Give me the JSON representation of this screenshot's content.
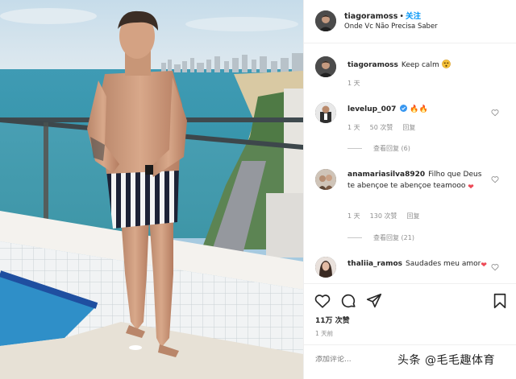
{
  "header": {
    "username": "tiagoramoss",
    "dot": "•",
    "follow_label": "关注",
    "location": "Onde Vc Não Precisa Saber"
  },
  "caption": {
    "username": "tiagoramoss",
    "text": "Keep calm",
    "emoji_icon": "dizzy-face-icon",
    "time": "1 天"
  },
  "comments": [
    {
      "username": "levelup_007",
      "verified": true,
      "text": "🔥🔥",
      "time": "1 天",
      "likes": "50 次赞",
      "reply_label": "回复",
      "view_replies": "查看回复 (6)"
    },
    {
      "username": "anamariasilva8920",
      "verified": false,
      "text": "Filho que Deus te abençoe te abençoe teamooo",
      "text_emoji": "❤",
      "time": "1 天",
      "likes": "130 次赞",
      "reply_label": "回复",
      "view_replies": "查看回复 (21)"
    },
    {
      "username": "thaliia_ramos",
      "verified": false,
      "text": "Saudades meu amor",
      "text_emoji": "❤",
      "time": "",
      "likes": "",
      "reply_label": ""
    }
  ],
  "actions": {
    "like_icon": "heart-icon",
    "comment_icon": "comment-icon",
    "share_icon": "share-icon",
    "save_icon": "bookmark-icon",
    "likes": "11万 次赞",
    "time": "1 天前"
  },
  "composer": {
    "placeholder": "添加评论..."
  },
  "watermark": "头条 @毛毛趣体育",
  "colors": {
    "link_blue": "#0095f6",
    "text": "#262626",
    "muted": "#8e8e8e",
    "heart_red": "#ed4956",
    "verified_blue": "#3897f0"
  }
}
